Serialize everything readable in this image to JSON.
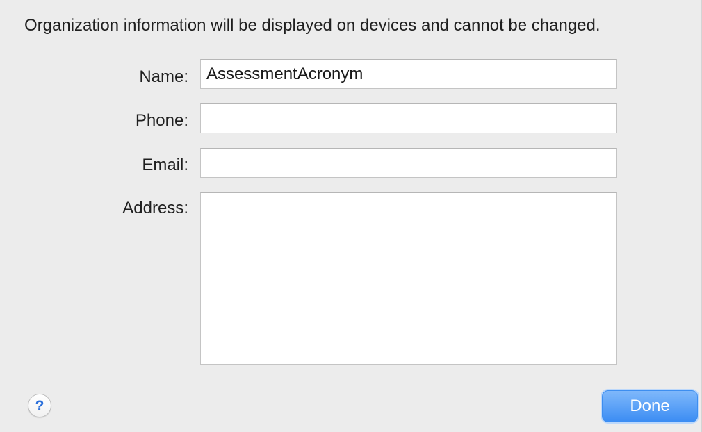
{
  "dialog": {
    "info_text": "Organization information will be displayed on devices and cannot be changed."
  },
  "form": {
    "name": {
      "label": "Name:",
      "value": "AssessmentAcronym"
    },
    "phone": {
      "label": "Phone:",
      "value": ""
    },
    "email": {
      "label": "Email:",
      "value": ""
    },
    "address": {
      "label": "Address:",
      "value": ""
    }
  },
  "footer": {
    "help_icon_glyph": "?",
    "help_icon": "question-mark-icon",
    "done_label": "Done"
  },
  "colors": {
    "background": "#ececec",
    "accent": "#3c8df3",
    "help_glyph": "#2a6fdb"
  }
}
